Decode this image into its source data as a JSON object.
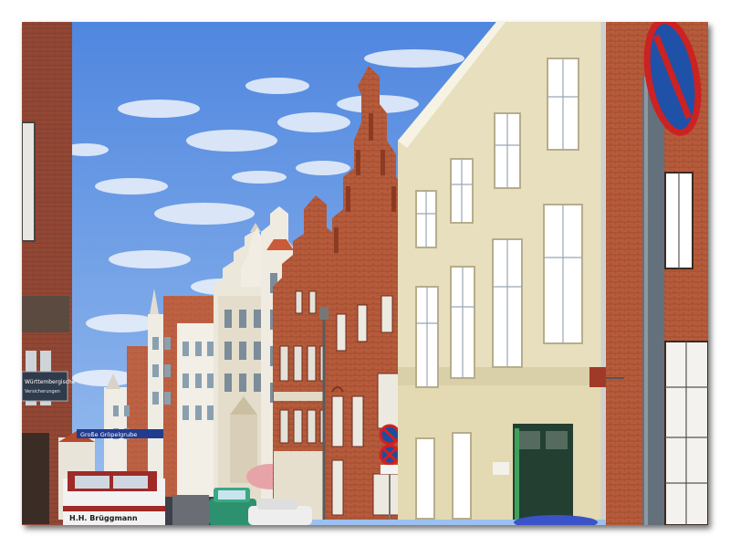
{
  "photo": {
    "subject": "street-of-historic-gabled-townhouses",
    "signs": {
      "wall_sign_line1": "Württembergische",
      "wall_sign_line2": "Versicherungen",
      "street_sign": "Große Gröpelgrube",
      "truck_lettering": "H.H. Brüggmann"
    },
    "colors": {
      "sky": "#5f93e3",
      "cloud": "#eef3fb",
      "brick": "#b55a3a",
      "cream_facade": "#e6ddb8",
      "door_green": "#1f4c3a"
    }
  }
}
